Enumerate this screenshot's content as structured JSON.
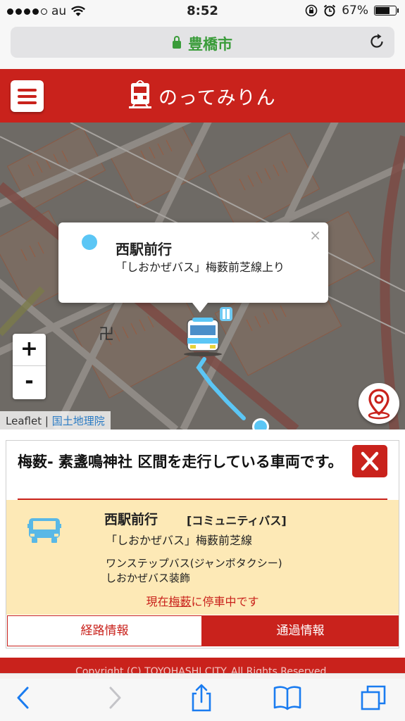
{
  "status_bar": {
    "carrier": "au",
    "time": "8:52",
    "battery": "67%"
  },
  "browser": {
    "url_title": "豊橋市"
  },
  "header": {
    "app_name": "のってみりん"
  },
  "map": {
    "zoom_in": "+",
    "zoom_out": "-",
    "attribution_leaflet": "Leaflet",
    "attribution_separator": "|",
    "attribution_gsi": "国土地理院",
    "popup": {
      "destination": "西駅前行",
      "route": "「しおかぜバス」梅薮前芝線上り",
      "close": "×"
    }
  },
  "panel": {
    "title": "梅薮- 素盞鳴神社 区間を走行している車両です。",
    "vehicle": {
      "destination": "西駅前行",
      "type": "[コミュニティバス]",
      "route": "「しおかぜバス」梅薮前芝線",
      "model": "ワンステップバス(ジャンボタクシー)",
      "decoration": "しおかぜバス装飾",
      "status_prefix": "現在",
      "status_stop": "梅薮",
      "status_suffix": "に停車中です"
    },
    "tabs": {
      "route_info": "経路情報",
      "passing_info": "通過情報"
    }
  },
  "footer": {
    "copyright": "Copyright (C) TOYOHASHI CITY. All Rights Reserved."
  },
  "colors": {
    "brand_red": "#c9221c",
    "vehicle_bg": "#fde9b6",
    "route_line": "#5bc6f5",
    "url_green": "#3a9c3a"
  }
}
